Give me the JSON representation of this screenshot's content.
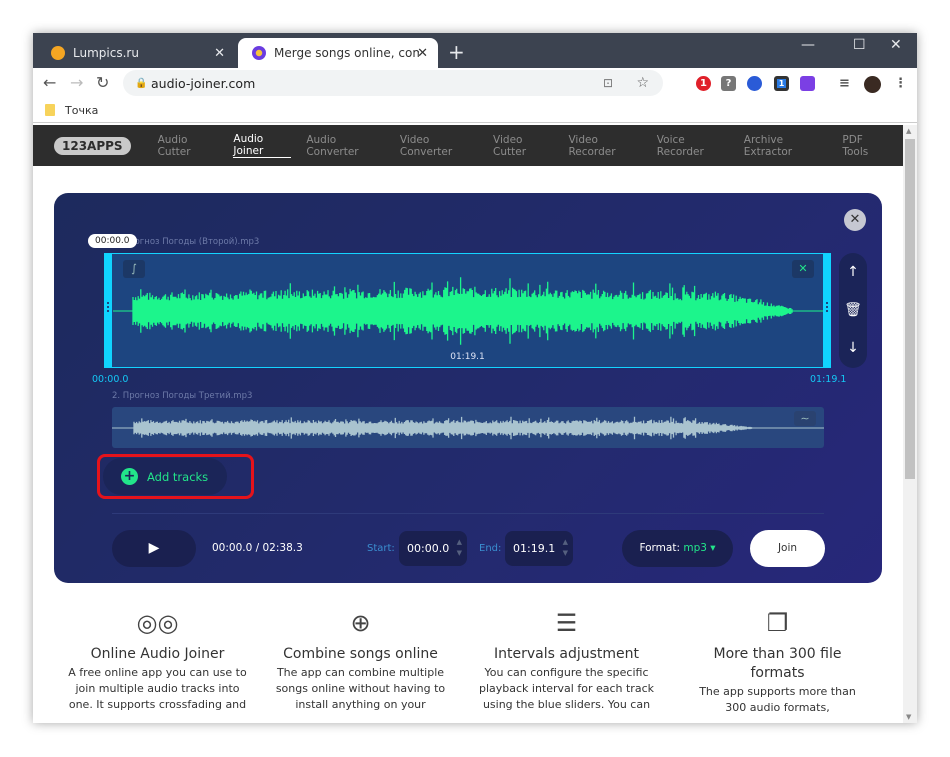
{
  "browser": {
    "tabs": [
      {
        "title": "Lumpics.ru",
        "favicon_color": "#f5a623"
      },
      {
        "title": "Merge songs online, combine mp",
        "favicon_color": "#6a3ce0"
      }
    ],
    "url": "audio-joiner.com",
    "bookmark": "Точка",
    "ext_badges": [
      "1",
      "?",
      "1"
    ]
  },
  "site": {
    "logo": "123APPS",
    "nav": [
      "Audio Cutter",
      "Audio Joiner",
      "Audio Converter",
      "Video Converter",
      "Video Cutter",
      "Video Recorder",
      "Voice Recorder",
      "Archive Extractor",
      "PDF Tools"
    ],
    "active": "Audio Joiner"
  },
  "editor": {
    "tracks": [
      {
        "name": "1. Прогноз Погоды (Второй).mp3",
        "tooltip": "00:00.0",
        "duration": "01:19.1",
        "start": "00:00.0",
        "end": "01:19.1",
        "wave_color": "#1cf58c"
      },
      {
        "name": "2. Прогноз Погоды Третий.mp3",
        "wave_color": "#a9c3cf"
      }
    ],
    "add_tracks": "Add tracks",
    "time": "00:00.0 / 02:38.3",
    "start_label": "Start:",
    "start": "00:00.0",
    "end_label": "End:",
    "end": "01:19.1",
    "format_label": "Format:",
    "format": "mp3",
    "join": "Join",
    "accent": "#13d3ff"
  },
  "features": [
    {
      "icon": "vinyl-records-icon",
      "title": "Online Audio Joiner",
      "lines": [
        "A free online app you can use to",
        "join multiple audio tracks into",
        "one. It supports crossfading and"
      ]
    },
    {
      "icon": "globe-icon",
      "title": "Combine songs online",
      "lines": [
        "The app can combine multiple",
        "songs online without having to",
        "install anything on your"
      ]
    },
    {
      "icon": "sliders-icon",
      "title": "Intervals adjustment",
      "lines": [
        "You can configure the specific",
        "playback interval for each track",
        "using the blue sliders. You can"
      ]
    },
    {
      "icon": "files-icon",
      "title": "More than 300 file formats",
      "lines": [
        "The app supports more than",
        "300 audio formats,"
      ]
    }
  ]
}
